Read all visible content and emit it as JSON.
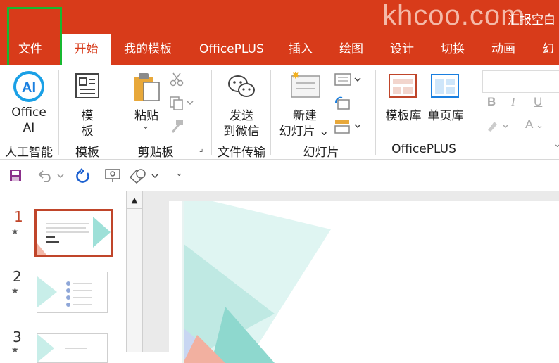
{
  "watermark": "khcoo.com",
  "document_title": "汇报空白",
  "tabs": [
    {
      "label": "文件"
    },
    {
      "label": "开始"
    },
    {
      "label": "我的模板"
    },
    {
      "label": "OfficePLUS"
    },
    {
      "label": "插入"
    },
    {
      "label": "绘图"
    },
    {
      "label": "设计"
    },
    {
      "label": "切换"
    },
    {
      "label": "动画"
    },
    {
      "label": "幻"
    }
  ],
  "ribbon": {
    "office_ai": {
      "line1": "Office",
      "line2": "AI",
      "group": "人工智能"
    },
    "template": {
      "line1": "模",
      "line2": "板",
      "group": "模板"
    },
    "paste": {
      "label": "粘贴",
      "group": "剪贴板"
    },
    "send_wechat": {
      "line1": "发送",
      "line2": "到微信",
      "group": "文件传输"
    },
    "new_slide": {
      "line1": "新建",
      "line2": "幻灯片",
      "group": "幻灯片"
    },
    "template_lib": {
      "label": "模板库",
      "group": "OfficePLUS"
    },
    "single_page_lib": {
      "label": "单页库"
    },
    "font": {
      "bold": "B",
      "italic": "I",
      "underline": "U",
      "color": "A"
    }
  },
  "slides": [
    {
      "number": "1"
    },
    {
      "number": "2"
    },
    {
      "number": "3"
    }
  ],
  "colors": {
    "accent": "#d83b1a",
    "selection": "#c0452a",
    "highlight": "#17b830",
    "teal": "#7fd8d0"
  }
}
